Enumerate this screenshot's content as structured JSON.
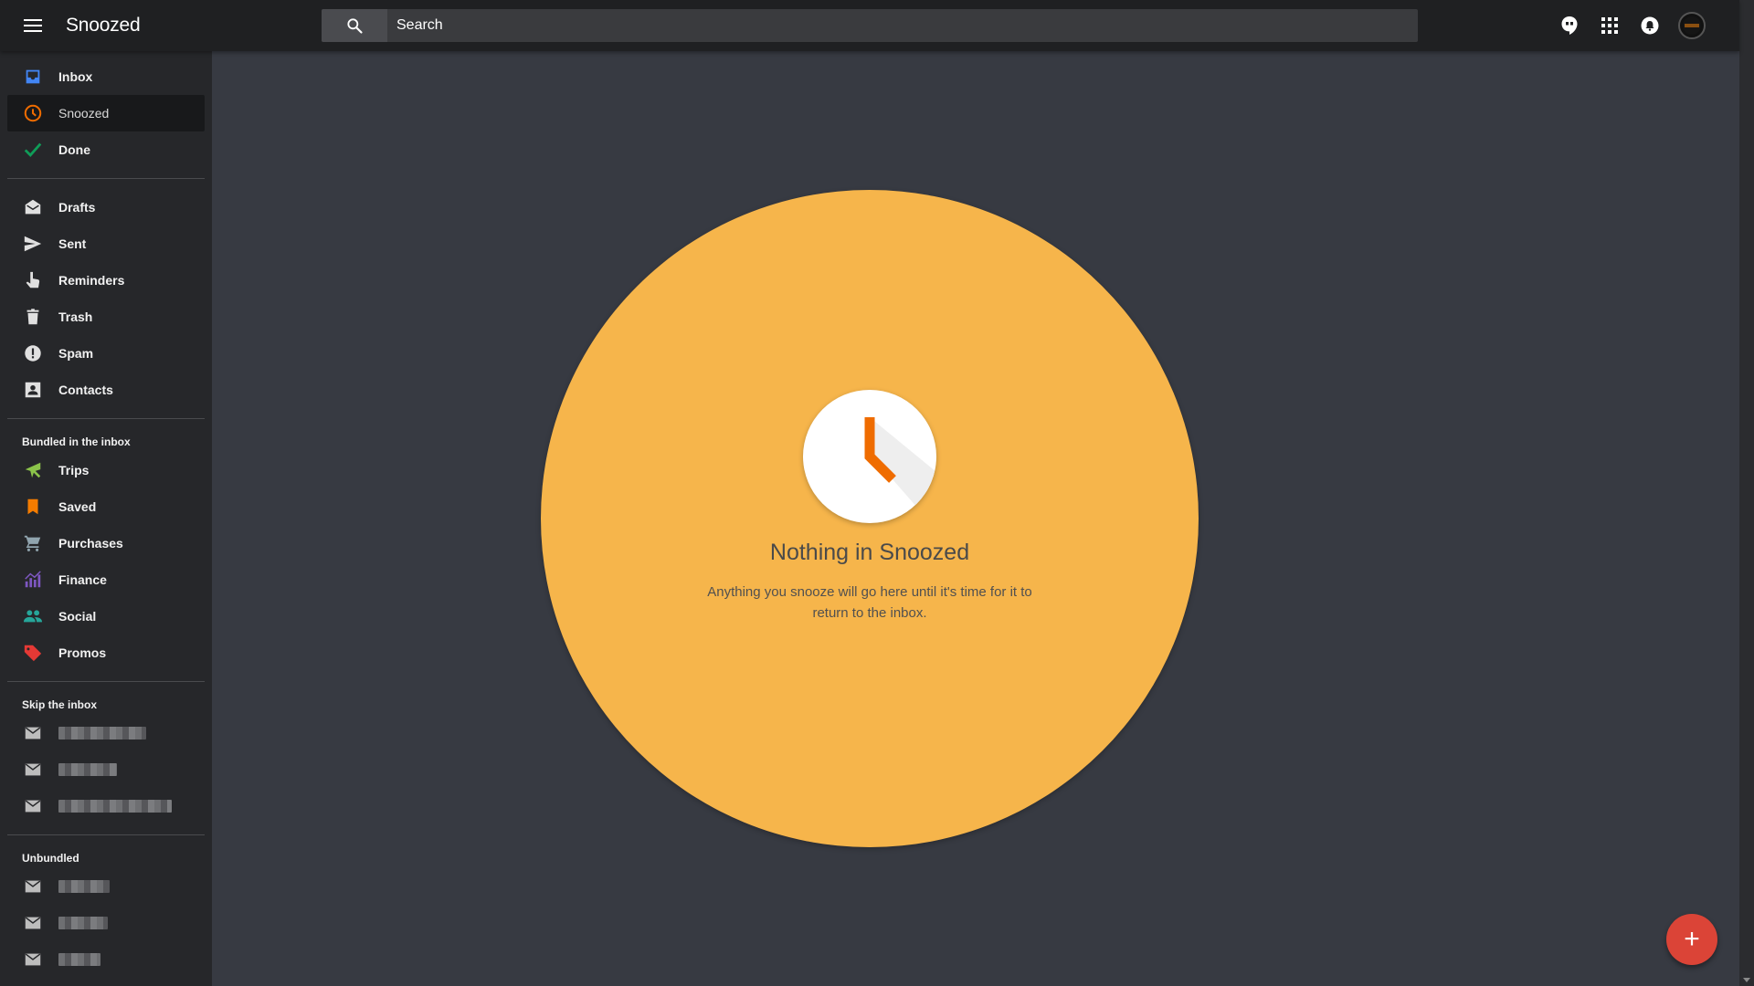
{
  "header": {
    "app_title": "Snoozed",
    "search_placeholder": "Search"
  },
  "sidebar": {
    "items": [
      {
        "label": "Inbox",
        "icon": "inbox-icon",
        "color": "#4285f4"
      },
      {
        "label": "Snoozed",
        "icon": "clock-icon",
        "color": "#ef6c00",
        "active": true
      },
      {
        "label": "Done",
        "icon": "check-icon",
        "color": "#0f9d58"
      }
    ],
    "system_items": [
      {
        "label": "Drafts",
        "icon": "drafts-icon"
      },
      {
        "label": "Sent",
        "icon": "send-icon"
      },
      {
        "label": "Reminders",
        "icon": "reminder-hand-icon"
      },
      {
        "label": "Trash",
        "icon": "trash-icon"
      },
      {
        "label": "Spam",
        "icon": "spam-icon"
      },
      {
        "label": "Contacts",
        "icon": "contacts-icon"
      }
    ],
    "bundled_label": "Bundled in the inbox",
    "bundles": [
      {
        "label": "Trips",
        "icon": "plane-icon",
        "color": "#8bc34a"
      },
      {
        "label": "Saved",
        "icon": "bookmark-icon",
        "color": "#f57c00"
      },
      {
        "label": "Purchases",
        "icon": "cart-icon",
        "color": "#78909c"
      },
      {
        "label": "Finance",
        "icon": "chart-icon",
        "color": "#7e57c2"
      },
      {
        "label": "Social",
        "icon": "people-icon",
        "color": "#26a69a"
      },
      {
        "label": "Promos",
        "icon": "tag-icon",
        "color": "#e53935"
      }
    ],
    "skip_label": "Skip the inbox",
    "unbundled_label": "Unbundled"
  },
  "main": {
    "empty_title": "Nothing in Snoozed",
    "empty_description": "Anything you snooze will go here until it's time for it to return to the inbox.",
    "accent_color": "#f6b54b",
    "clock_color": "#ef6c00"
  },
  "fab": {
    "label": "+",
    "color": "#db4437"
  }
}
